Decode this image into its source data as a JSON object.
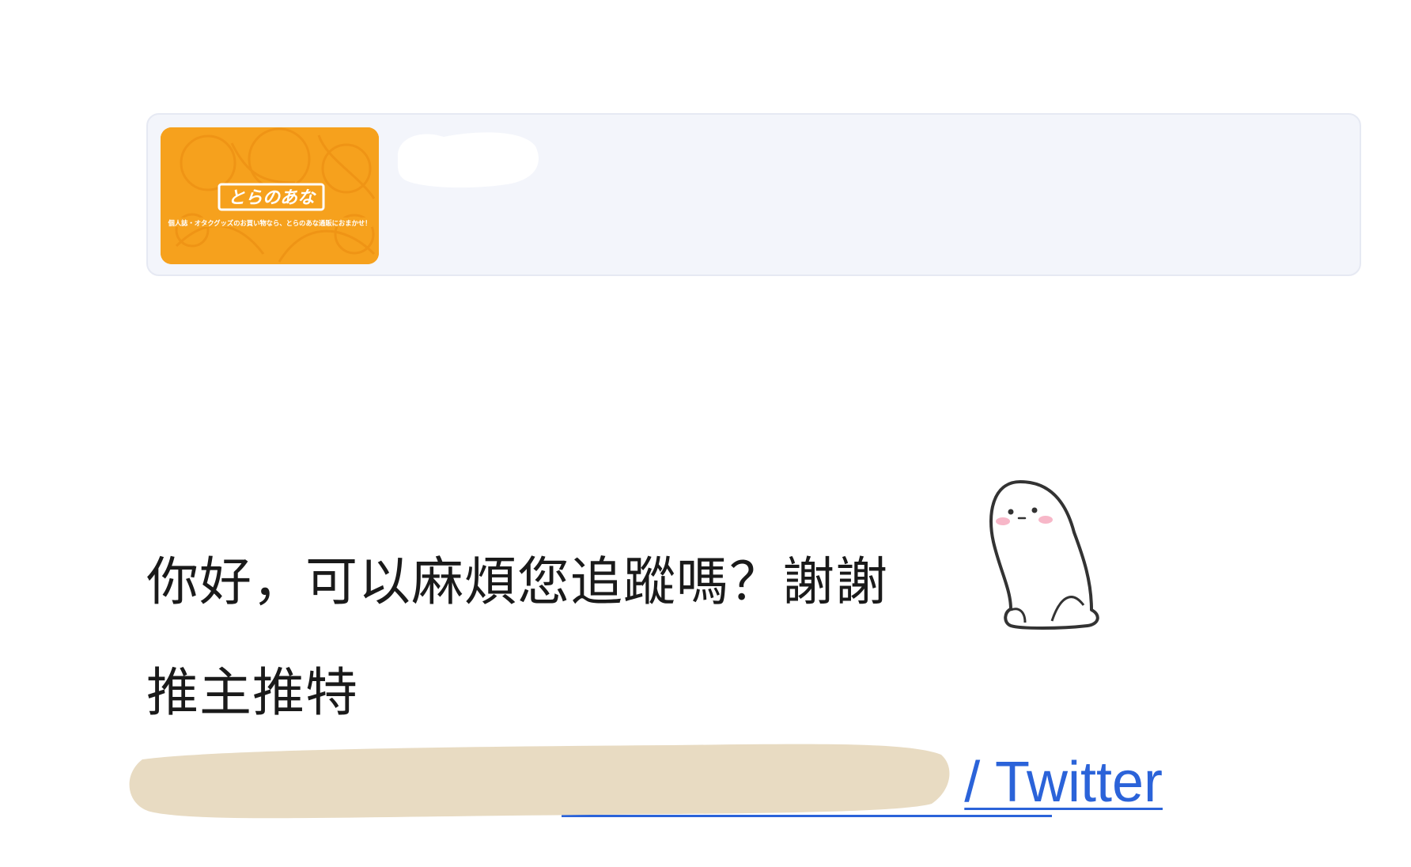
{
  "link_preview": {
    "thumbnail_icon": "toranoana-banner",
    "thumbnail_logo_text": "とらのあな",
    "thumbnail_caption": "個人誌・オタクグッズのお買い物なら、とらのあな通販におまかせ！",
    "title_redacted": true
  },
  "message": {
    "line1": "你好，可以麻煩您追蹤嗎？謝謝",
    "line2": "推主推特",
    "sticker_icon": "shy-ghost-sticker"
  },
  "profile_link": {
    "visible_suffix": "/ Twitter",
    "redacted": true
  },
  "colors": {
    "card_background": "#f3f5fb",
    "thumbnail_orange": "#f6a11d",
    "link_blue": "#2b63d9",
    "redaction_beige": "#e8dbc2",
    "redaction_white": "#ffffff"
  }
}
